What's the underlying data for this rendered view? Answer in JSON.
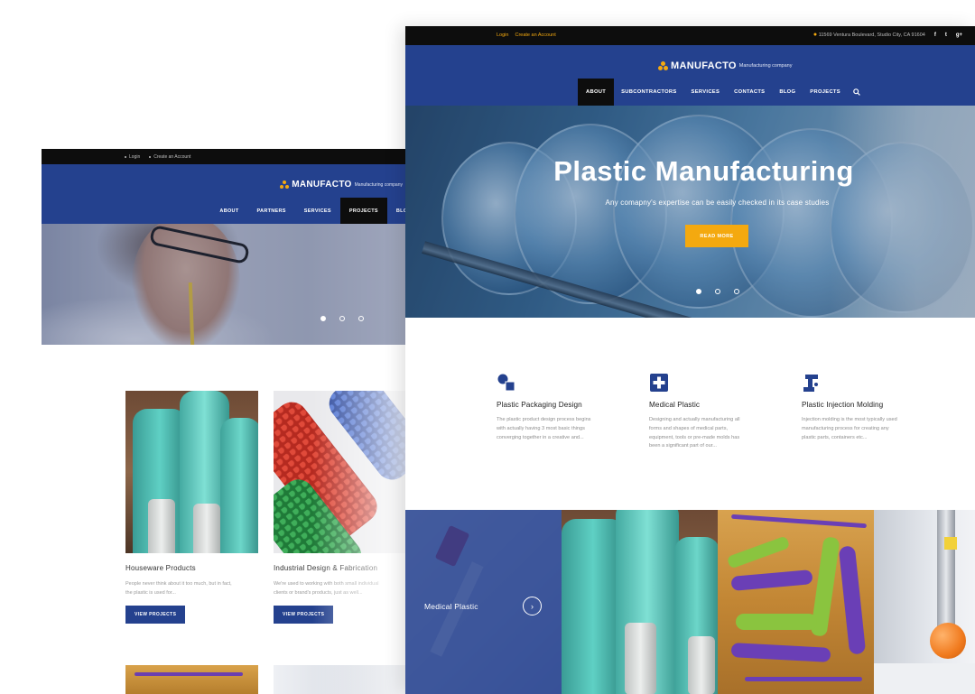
{
  "back": {
    "topbar": {
      "login": "Login",
      "create": "Create an Account"
    },
    "logo": {
      "brand": "MANUFACTO",
      "tagline": "Manufacturing company"
    },
    "nav": [
      "ABOUT",
      "PARTNERS",
      "SERVICES",
      "PROJECTS",
      "BLOG"
    ],
    "active_nav": "PROJECTS",
    "cards": [
      {
        "title": "Houseware Products",
        "desc1": "People never think about it too much, but in fact,",
        "desc2": "the plastic is used for...",
        "button": "VIEW PROJECTS"
      },
      {
        "title": "Industrial Design & Fabrication",
        "desc1": "We're used to working with both small individual",
        "desc2": "clients or brand's products, just as well...",
        "button": "VIEW PROJECTS"
      }
    ]
  },
  "front": {
    "topbar": {
      "login": "Login",
      "create": "Create an Account",
      "address": "11569 Ventura Boulevard, Studio City, CA 91604",
      "social": [
        "f",
        "t",
        "g+"
      ]
    },
    "logo": {
      "brand": "MANUFACTO",
      "tagline": "Manufacturing company"
    },
    "nav": [
      "ABOUT",
      "SUBCONTRACTORS",
      "SERVICES",
      "CONTACTS",
      "BLOG",
      "PROJECTS"
    ],
    "active_nav": "ABOUT",
    "hero": {
      "title": "Plastic Manufacturing",
      "subtitle": "Any comapny's expertise can be easily checked in its case studies",
      "cta": "READ MORE"
    },
    "features": [
      {
        "icon": "packaging-icon",
        "title": "Plastic Packaging Design",
        "desc": [
          "The plastic product design process begins",
          "with actually having 3 most basic things",
          "converging together in a creative and..."
        ]
      },
      {
        "icon": "medical-cross-icon",
        "title": "Medical Plastic",
        "desc": [
          "Designing and actually manufacturing all",
          "forms and shapes of medical parts,",
          "equipment, tools or pre-made molds has",
          "been a significant part of our..."
        ]
      },
      {
        "icon": "injection-molding-icon",
        "title": "Plastic Injection Molding",
        "desc": [
          "Injection molding is the most typically used",
          "manufacturing process for creating any",
          "plastic parts, containers etc..."
        ]
      }
    ],
    "gallery": {
      "first_label": "Medical Plastic"
    }
  },
  "colors": {
    "brand_blue": "#24418e",
    "accent_orange": "#f4a90f",
    "topbar_black": "#0d0d0d"
  }
}
